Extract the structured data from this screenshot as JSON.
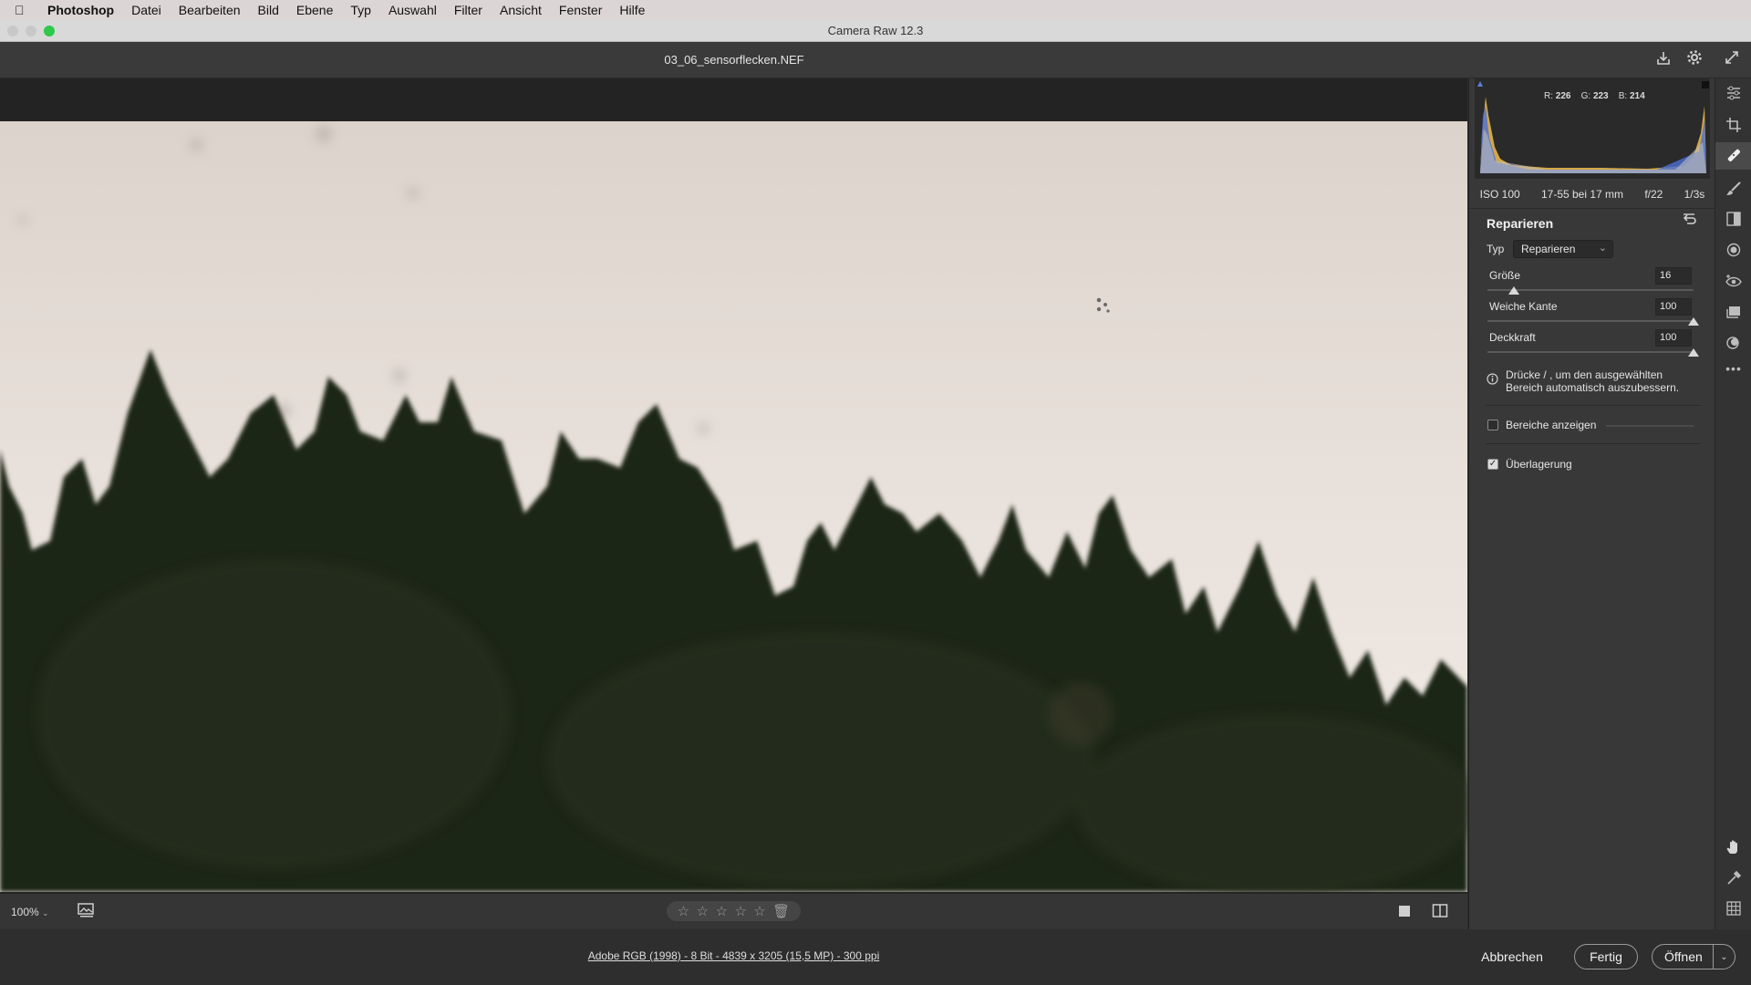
{
  "menubar": {
    "apple": "",
    "items": [
      "Photoshop",
      "Datei",
      "Bearbeiten",
      "Bild",
      "Ebene",
      "Typ",
      "Auswahl",
      "Filter",
      "Ansicht",
      "Fenster",
      "Hilfe"
    ]
  },
  "window": {
    "title": "Camera Raw 12.3"
  },
  "file": {
    "name": "03_06_sensorflecken.NEF"
  },
  "histogram": {
    "r_label": "R:",
    "r": "226",
    "g_label": "G:",
    "g": "223",
    "b_label": "B:",
    "b": "214"
  },
  "exif": {
    "iso": "ISO 100",
    "lens": "17-55 bei 17 mm",
    "aperture": "f/22",
    "shutter": "1/3s"
  },
  "panel": {
    "title": "Reparieren",
    "type_label": "Typ",
    "type_value": "Reparieren",
    "size_label": "Größe",
    "size_value": "16",
    "size_fraction": 0.13,
    "feather_label": "Weiche Kante",
    "feather_value": "100",
    "feather_fraction": 1.0,
    "opacity_label": "Deckkraft",
    "opacity_value": "100",
    "opacity_fraction": 1.0,
    "hint_line1": "Drücke / , um den ausgewählten",
    "hint_line2": "Bereich automatisch auszubessern.",
    "show_areas_label": "Bereiche anzeigen",
    "show_areas_checked": false,
    "overlay_label": "Überlagerung",
    "overlay_checked": true,
    "overlay_check_glyph": "✓"
  },
  "statusbar": {
    "zoom": "100%",
    "stars_count": 5
  },
  "footer": {
    "info": "Adobe RGB (1998) - 8 Bit - 4839 x 3205 (15,5 MP) - 300 ppi",
    "cancel": "Abbrechen",
    "done": "Fertig",
    "open": "Öffnen"
  },
  "colors": {
    "accent_sky": "#e7ddd5",
    "forest": "#1f2619",
    "panel_bg": "#383838"
  }
}
